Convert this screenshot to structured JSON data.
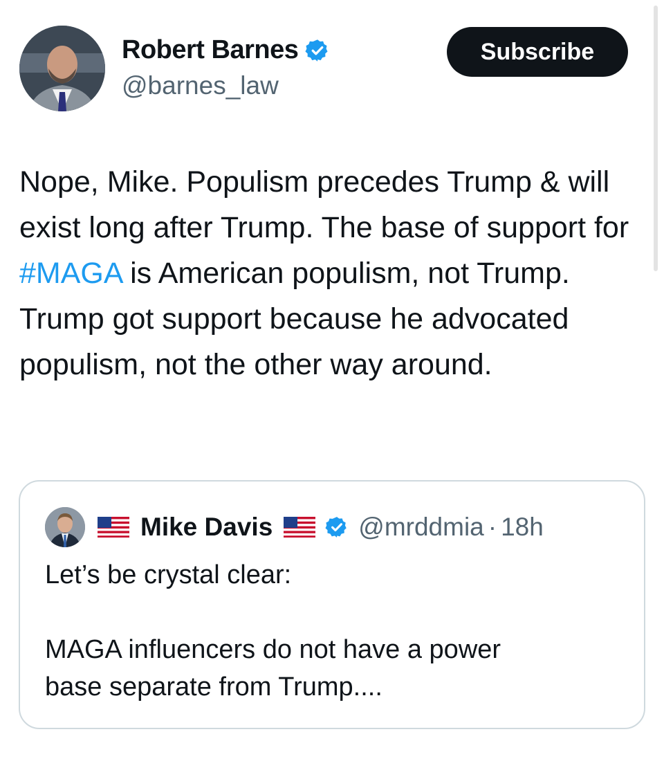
{
  "author": {
    "name": "Robert Barnes",
    "handle": "@barnes_law",
    "verified_icon": "verified-badge-icon",
    "subscribe_label": "Subscribe"
  },
  "tweet": {
    "text_before": "Nope, Mike. Populism precedes Trump & will exist long after Trump. The base of support for ",
    "hashtag": "#MAGA",
    "text_after": " is American populism, not Trump. Trump got support because he advocated populism, not the other way around."
  },
  "quoted_tweet": {
    "name": "Mike Davis",
    "flag_icon": "us-flag-icon",
    "handle": "@mrddmia",
    "separator": "·",
    "time": "18h",
    "lines": [
      "Let’s be crystal clear:",
      "",
      "MAGA influencers do not have a power",
      "base separate from Trump...."
    ]
  },
  "colors": {
    "text": "#0f1419",
    "secondary": "#536471",
    "link": "#1d9bf0",
    "verified": "#1d9bf0",
    "border": "#cfd9de"
  }
}
